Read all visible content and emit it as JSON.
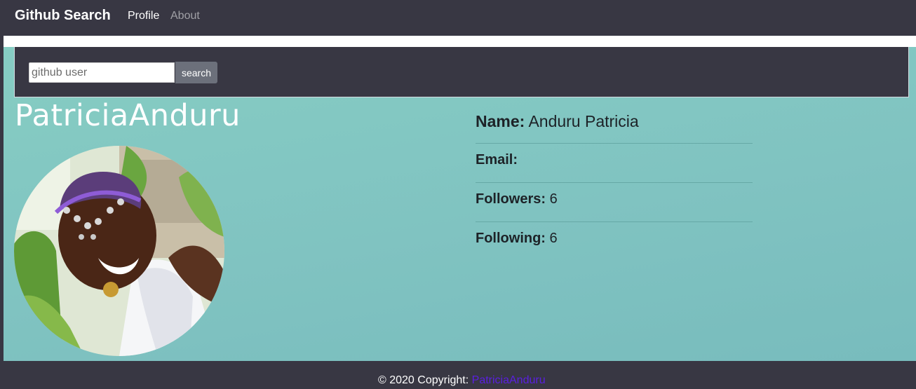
{
  "navbar": {
    "brand": "Github Search",
    "links": [
      {
        "label": "Profile"
      },
      {
        "label": "About"
      }
    ]
  },
  "search": {
    "placeholder": "github user",
    "value": "",
    "button_label": "search"
  },
  "profile": {
    "username": "PatriciaAnduru",
    "details": [
      {
        "label": "Name:",
        "value": "Anduru Patricia"
      },
      {
        "label": "Email:",
        "value": ""
      },
      {
        "label": "Followers:",
        "value": "6"
      },
      {
        "label": "Following:",
        "value": "6"
      }
    ]
  },
  "footer": {
    "copyright": "© 2020 Copyright:",
    "link_label": "PatriciaAnduru"
  },
  "colors": {
    "navbar_bg": "#383743",
    "teal_bg": "#80c3c1",
    "footer_link": "#5a1fe0"
  }
}
